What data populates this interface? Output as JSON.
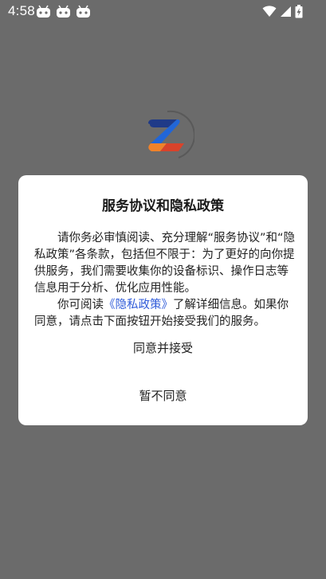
{
  "status_bar": {
    "time": "4:58",
    "app_icons": [
      "android-icon",
      "android-icon",
      "android-icon"
    ],
    "system_icons": [
      "wifi-icon",
      "cell-signal-icon",
      "battery-charging-icon"
    ]
  },
  "splash": {
    "logo": "z-logo",
    "colors": {
      "orange": "#f0822a",
      "red": "#d9432b",
      "blue": "#2166d8",
      "navy": "#1f3a88"
    }
  },
  "dialog": {
    "title": "服务协议和隐私政策",
    "paragraph1": "请你务必审慎阅读、充分理解“服务协议”和“隐私政策”各条款，包括但不限于：为了更好的向你提供服务，我们需要收集你的设备标识、操作日志等信息用于分析、优化应用性能。",
    "paragraph2_prefix": "你可阅读",
    "paragraph2_link": "《隐私政策》",
    "paragraph2_suffix": "了解详细信息。如果你同意，请点击下面按钮开始接受我们的服务。",
    "accept_label": "同意并接受",
    "decline_label": "暂不同意",
    "link_color": "#2f5bd9"
  }
}
